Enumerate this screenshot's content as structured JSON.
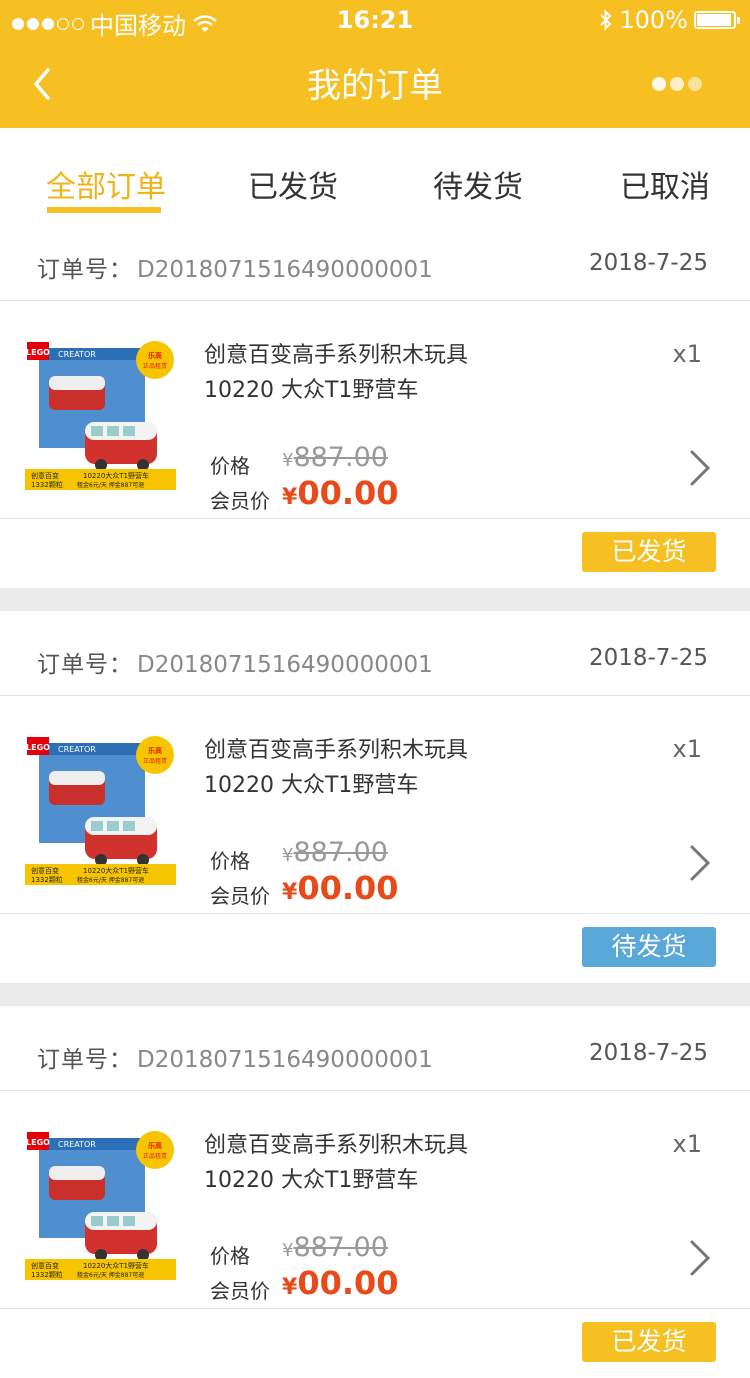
{
  "status_bar": {
    "carrier": "中国移动",
    "time": "16:21",
    "battery": "100%",
    "battery_level": 1.0
  },
  "nav": {
    "title": "我的订单"
  },
  "tabs": [
    {
      "label": "全部订单",
      "active": true
    },
    {
      "label": "已发货",
      "active": false
    },
    {
      "label": "待发货",
      "active": false
    },
    {
      "label": "已取消",
      "active": false
    }
  ],
  "orders": [
    {
      "order_no_label": "订单号：",
      "order_no": "D2018071516490000001",
      "date": "2018-7-25",
      "product_line1": "创意百变高手系列积木玩具",
      "product_line2": "10220 大众T1野营车",
      "qty": "x1",
      "price_label": "价格",
      "price_currency": "¥",
      "price": "887.00",
      "member_label": "会员价",
      "member_currency": "¥",
      "member_price": "00.00",
      "status": "已发货",
      "status_color": "#f6bf22"
    },
    {
      "order_no_label": "订单号：",
      "order_no": "D2018071516490000001",
      "date": "2018-7-25",
      "product_line1": "创意百变高手系列积木玩具",
      "product_line2": "10220 大众T1野营车",
      "qty": "x1",
      "price_label": "价格",
      "price_currency": "¥",
      "price": "887.00",
      "member_label": "会员价",
      "member_currency": "¥",
      "member_price": "00.00",
      "status": "待发货",
      "status_color": "#5aa8d8"
    },
    {
      "order_no_label": "订单号：",
      "order_no": "D2018071516490000001",
      "date": "2018-7-25",
      "product_line1": "创意百变高手系列积木玩具",
      "product_line2": "10220 大众T1野营车",
      "qty": "x1",
      "price_label": "价格",
      "price_currency": "¥",
      "price": "887.00",
      "member_label": "会员价",
      "member_currency": "¥",
      "member_price": "00.00",
      "status": "已发货",
      "status_color": "#f6bf22"
    }
  ],
  "product_image": {
    "brand": "LEGO",
    "series": "CREATOR",
    "badge_line1": "乐高",
    "badge_line2": "正品租赁",
    "banner_left1": "创意百变",
    "banner_left2": "1332颗粒",
    "banner_right1": "10220大众T1野营车",
    "banner_right2": "租金6元/天  押金887可退"
  }
}
